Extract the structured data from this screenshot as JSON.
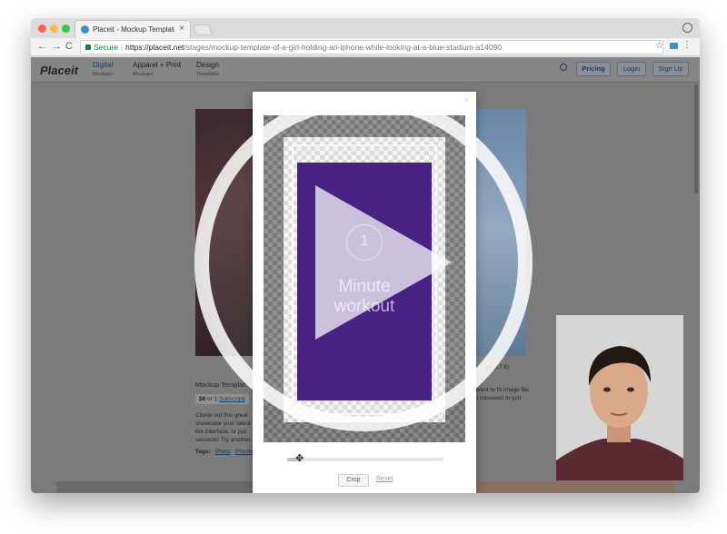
{
  "browser": {
    "tab_title": "Placeit - Mockup Template Of",
    "tab_close": "×",
    "nav_back": "←",
    "nav_forward": "→",
    "nav_reload": "C",
    "secure_label": "Secure",
    "url_host": "https://placeit.net",
    "url_path": "/stages/mockup-template-of-a-girl-holding-an-iphone-while-looking-at-a-blue-stadium-a14090",
    "star": "☆",
    "menu": "⋮"
  },
  "site": {
    "logo": "Placeit",
    "nav": [
      {
        "label": "Digital",
        "sub": "Mockups"
      },
      {
        "label": "Apparel + Print",
        "sub": "Mockups"
      },
      {
        "label": "Design",
        "sub": "Templates"
      }
    ],
    "buttons": {
      "pricing": "Pricing",
      "login": "Login",
      "signup": "Sign Up"
    }
  },
  "product": {
    "title": "Mockup Templat",
    "price": "$8",
    "price_or": "or 1",
    "subscription_link": "Subscripti",
    "right_caption": "ge (17.6)",
    "desc_left": "Check out this great showcase your latest the interface, or put seconds! Try another",
    "desc_right": "y want to ht image file on rocessed in just",
    "tags_label": "Tags:",
    "tags": [
      "Photo",
      "iPhone"
    ]
  },
  "modal": {
    "close": "×",
    "poster": {
      "number": "1",
      "line1": "Minute",
      "line2": "workout"
    },
    "zoom_fraction": 0.08,
    "crop_label": "Crop",
    "reset_label": "Reset"
  },
  "colors": {
    "poster_bg": "#3a0f78",
    "poster_text": "#b9a4dd",
    "overlay": "#ffffff",
    "brand_link": "#1b3a66"
  }
}
